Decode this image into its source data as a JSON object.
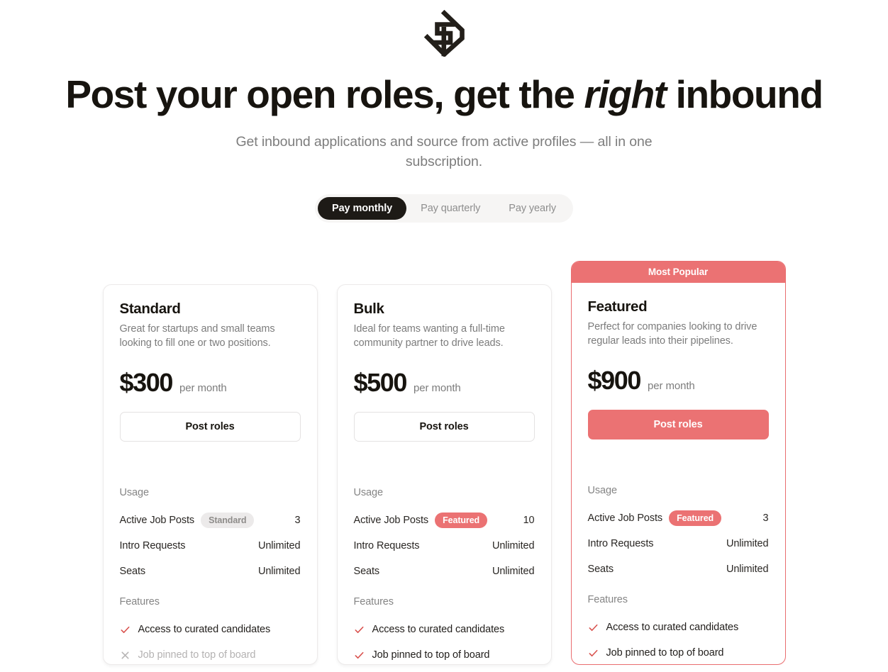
{
  "brand": {
    "logo_icon": "pallet-logo-icon",
    "logo_color": "#231f1a"
  },
  "hero": {
    "headline_part1": "Post your open roles, get the ",
    "headline_emphasis": "right",
    "headline_part2": " inbound",
    "subheadline": "Get inbound applications and source from active profiles — all in one subscription."
  },
  "billing_toggle": {
    "selected": "Pay monthly",
    "options": [
      {
        "label": "Pay monthly",
        "active": true
      },
      {
        "label": "Pay quarterly",
        "active": false
      },
      {
        "label": "Pay yearly",
        "active": false
      }
    ]
  },
  "colors": {
    "accent_coral": "#eb7273",
    "text_dark": "#17140f",
    "text_muted": "#7c7c7c",
    "badge_gray_bg": "#eceaea",
    "toggle_bg": "#f6f5f4",
    "toggle_active_bg": "#1d1a16"
  },
  "plans": [
    {
      "name": "Standard",
      "description": "Great for startups and small teams looking to fill one or two positions.",
      "price": "$300",
      "period": "per month",
      "cta_label": "Post roles",
      "cta_style": "outline",
      "highlighted": false,
      "banner": null,
      "usage_label": "Usage",
      "usage": [
        {
          "name": "Active Job Posts",
          "badge": "Standard",
          "badge_style": "gray",
          "value": "3"
        },
        {
          "name": "Intro Requests",
          "badge": null,
          "badge_style": null,
          "value": "Unlimited"
        },
        {
          "name": "Seats",
          "badge": null,
          "badge_style": null,
          "value": "Unlimited"
        }
      ],
      "features_label": "Features",
      "features": [
        {
          "text": "Access to curated candidates",
          "included": true,
          "icon": "check-icon"
        },
        {
          "text": "Job pinned to top of board",
          "included": false,
          "icon": "x-icon"
        }
      ]
    },
    {
      "name": "Bulk",
      "description": "Ideal for teams wanting a full-time community partner to drive leads.",
      "price": "$500",
      "period": "per month",
      "cta_label": "Post roles",
      "cta_style": "outline",
      "highlighted": false,
      "banner": null,
      "usage_label": "Usage",
      "usage": [
        {
          "name": "Active Job Posts",
          "badge": "Featured",
          "badge_style": "coral",
          "value": "10"
        },
        {
          "name": "Intro Requests",
          "badge": null,
          "badge_style": null,
          "value": "Unlimited"
        },
        {
          "name": "Seats",
          "badge": null,
          "badge_style": null,
          "value": "Unlimited"
        }
      ],
      "features_label": "Features",
      "features": [
        {
          "text": "Access to curated candidates",
          "included": true,
          "icon": "check-icon"
        },
        {
          "text": "Job pinned to top of board",
          "included": true,
          "icon": "check-icon"
        }
      ]
    },
    {
      "name": "Featured",
      "description": "Perfect for companies looking to drive regular leads into their pipelines.",
      "price": "$900",
      "period": "per month",
      "cta_label": "Post roles",
      "cta_style": "solid",
      "highlighted": true,
      "banner": "Most Popular",
      "usage_label": "Usage",
      "usage": [
        {
          "name": "Active Job Posts",
          "badge": "Featured",
          "badge_style": "coral",
          "value": "3"
        },
        {
          "name": "Intro Requests",
          "badge": null,
          "badge_style": null,
          "value": "Unlimited"
        },
        {
          "name": "Seats",
          "badge": null,
          "badge_style": null,
          "value": "Unlimited"
        }
      ],
      "features_label": "Features",
      "features": [
        {
          "text": "Access to curated candidates",
          "included": true,
          "icon": "check-icon"
        },
        {
          "text": "Job pinned to top of board",
          "included": true,
          "icon": "check-icon"
        }
      ]
    }
  ]
}
